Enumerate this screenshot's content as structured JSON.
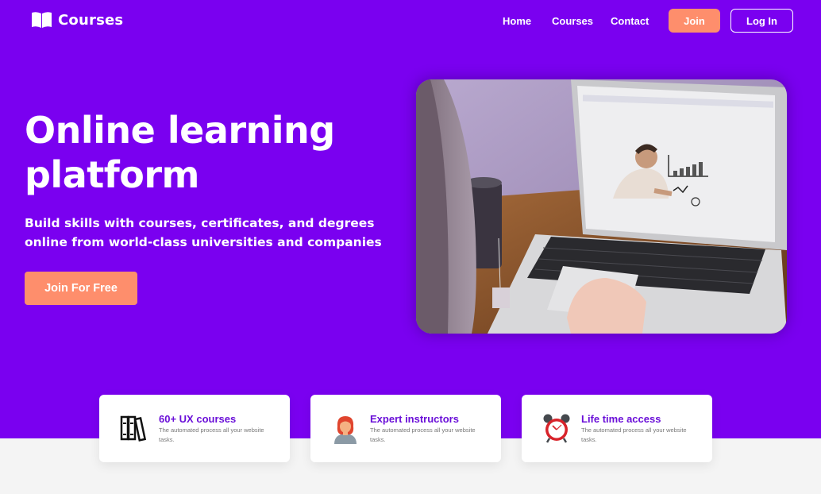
{
  "brand": {
    "name": "Courses",
    "icon": "book-icon"
  },
  "nav": {
    "links": [
      "Home",
      "Courses",
      "Contact"
    ],
    "join_label": "Join",
    "login_label": "Log In"
  },
  "hero": {
    "title_line1": "Online learning",
    "title_line2": "platform",
    "subtitle": "Build skills with courses, certificates, and degrees online from world-class universities and companies",
    "cta_label": "Join For Free",
    "image": "person-using-laptop-online-lesson"
  },
  "features": [
    {
      "title": "60+ UX courses",
      "text": "The automated process all your website tasks.",
      "icon": "books-icon"
    },
    {
      "title": "Expert instructors",
      "text": "The automated process all your website tasks.",
      "icon": "instructor-icon"
    },
    {
      "title": "Life time access",
      "text": "The automated process all your website tasks.",
      "icon": "alarm-clock-icon"
    }
  ],
  "colors": {
    "hero_bg": "#7a00f0",
    "accent": "#fe8e6c",
    "feature_title": "#6a0fd8",
    "page_bg": "#f4f4f4"
  }
}
